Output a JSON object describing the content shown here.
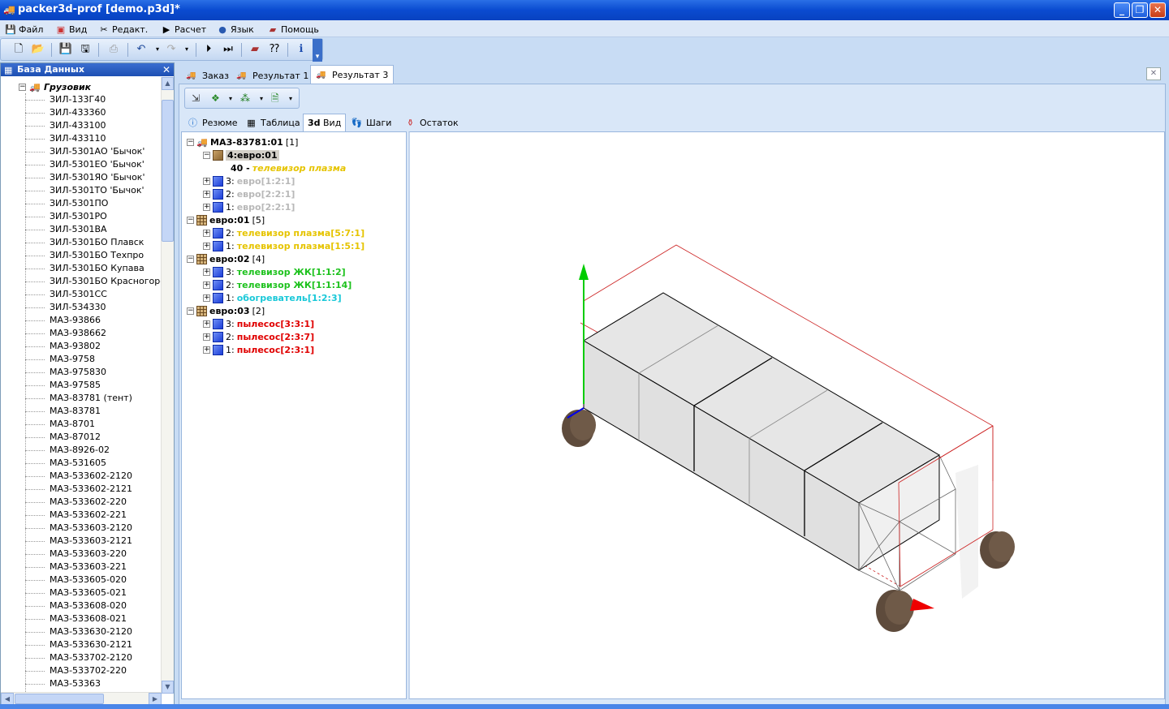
{
  "window": {
    "title": "packer3d-prof [demo.p3d]*",
    "buttons": {
      "minimize": "_",
      "restore": "❐",
      "close": "✕"
    }
  },
  "menu": [
    {
      "label": "Файл",
      "icon": "save-icon"
    },
    {
      "label": "Вид",
      "icon": "view-icon"
    },
    {
      "label": "Редакт.",
      "icon": "edit-icon"
    },
    {
      "label": "Расчет",
      "icon": "calc-icon"
    },
    {
      "label": "Язык",
      "icon": "globe-icon"
    },
    {
      "label": "Помощь",
      "icon": "help-book-icon"
    }
  ],
  "left_panel": {
    "title": "База Данных",
    "root": "Грузовик",
    "items": [
      "ЗИЛ-133Г40",
      "ЗИЛ-433360",
      "ЗИЛ-433100",
      "ЗИЛ-433110",
      "ЗИЛ-5301АО 'Бычок'",
      "ЗИЛ-5301ЕО 'Бычок'",
      "ЗИЛ-5301ЯО 'Бычок'",
      "ЗИЛ-5301ТО 'Бычок'",
      "ЗИЛ-5301ПО",
      "ЗИЛ-5301РО",
      "ЗИЛ-5301ВА",
      "ЗИЛ-5301БО Плавск",
      "ЗИЛ-5301БО Техпро",
      "ЗИЛ-5301БО Купава",
      "ЗИЛ-5301БО Красногорск",
      "ЗИЛ-5301СС",
      "ЗИЛ-534330",
      "МАЗ-93866",
      "МАЗ-938662",
      "МАЗ-93802",
      "МАЗ-9758",
      "МАЗ-975830",
      "МАЗ-97585",
      "МАЗ-83781 (тент)",
      "МАЗ-83781",
      "МАЗ-8701",
      "МАЗ-87012",
      "МАЗ-8926-02",
      "МАЗ-531605",
      "МАЗ-533602-2120",
      "МАЗ-533602-2121",
      "МАЗ-533602-220",
      "МАЗ-533602-221",
      "МАЗ-533603-2120",
      "МАЗ-533603-2121",
      "МАЗ-533603-220",
      "МАЗ-533603-221",
      "МАЗ-533605-020",
      "МАЗ-533605-021",
      "МАЗ-533608-020",
      "МАЗ-533608-021",
      "МАЗ-533630-2120",
      "МАЗ-533630-2121",
      "МАЗ-533702-2120",
      "МАЗ-533702-220",
      "МАЗ-53363"
    ]
  },
  "doc_tabs": [
    {
      "label": "Заказ",
      "active": false
    },
    {
      "label": "Результат 1",
      "active": false
    },
    {
      "label": "Результат 3",
      "active": true
    }
  ],
  "sub_tabs": [
    {
      "label": "Резюме",
      "icon": "info-icon",
      "active": false
    },
    {
      "label": "Таблица",
      "icon": "table-icon",
      "active": false
    },
    {
      "label": "Вид",
      "icon": "3d-icon",
      "icon_text": "3d",
      "active": true
    },
    {
      "label": "Шаги",
      "icon": "steps-icon",
      "active": false
    },
    {
      "label": "Остаток",
      "icon": "remainder-icon",
      "active": false
    }
  ],
  "result_tree": {
    "truck": {
      "name": "МАЗ-83781:01",
      "count": "[1]"
    },
    "selected_pallet": {
      "name": "4:евро:01"
    },
    "selected_item": {
      "qty": "40 -",
      "name": "телевизор плазма"
    },
    "truck_children": [
      {
        "idx": "3:",
        "label": "евро[1:2:1]"
      },
      {
        "idx": "2:",
        "label": "евро[2:2:1]"
      },
      {
        "idx": "1:",
        "label": "евро[2:2:1]"
      }
    ],
    "groups": [
      {
        "name": "евро:01",
        "count": "[5]",
        "children": [
          {
            "idx": "2:",
            "label": "телевизор плазма[5:7:1]",
            "color": "yellow"
          },
          {
            "idx": "1:",
            "label": "телевизор плазма[1:5:1]",
            "color": "yellow"
          }
        ]
      },
      {
        "name": "евро:02",
        "count": "[4]",
        "children": [
          {
            "idx": "3:",
            "label": "телевизор ЖК[1:1:2]",
            "color": "green"
          },
          {
            "idx": "2:",
            "label": "телевизор ЖК[1:1:14]",
            "color": "green"
          },
          {
            "idx": "1:",
            "label": "обогреватель[1:2:3]",
            "color": "cyan"
          }
        ]
      },
      {
        "name": "евро:03",
        "count": "[2]",
        "children": [
          {
            "idx": "3:",
            "label": "пылесос[3:3:1]",
            "color": "red"
          },
          {
            "idx": "2:",
            "label": "пылесос[2:3:7]",
            "color": "red"
          },
          {
            "idx": "1:",
            "label": "пылесос[2:3:1]",
            "color": "red"
          }
        ]
      }
    ]
  },
  "colors": {
    "titlebar": "#0a4bd0",
    "tree_yellow": "#e6c400",
    "tree_green": "#1ec21e",
    "tree_cyan": "#19c8d8",
    "tree_red": "#e00000",
    "wheel": "#5e4b3c",
    "axis_y": "#00cc00",
    "axis_x": "#ee0000",
    "axis_z": "#0000ee"
  }
}
